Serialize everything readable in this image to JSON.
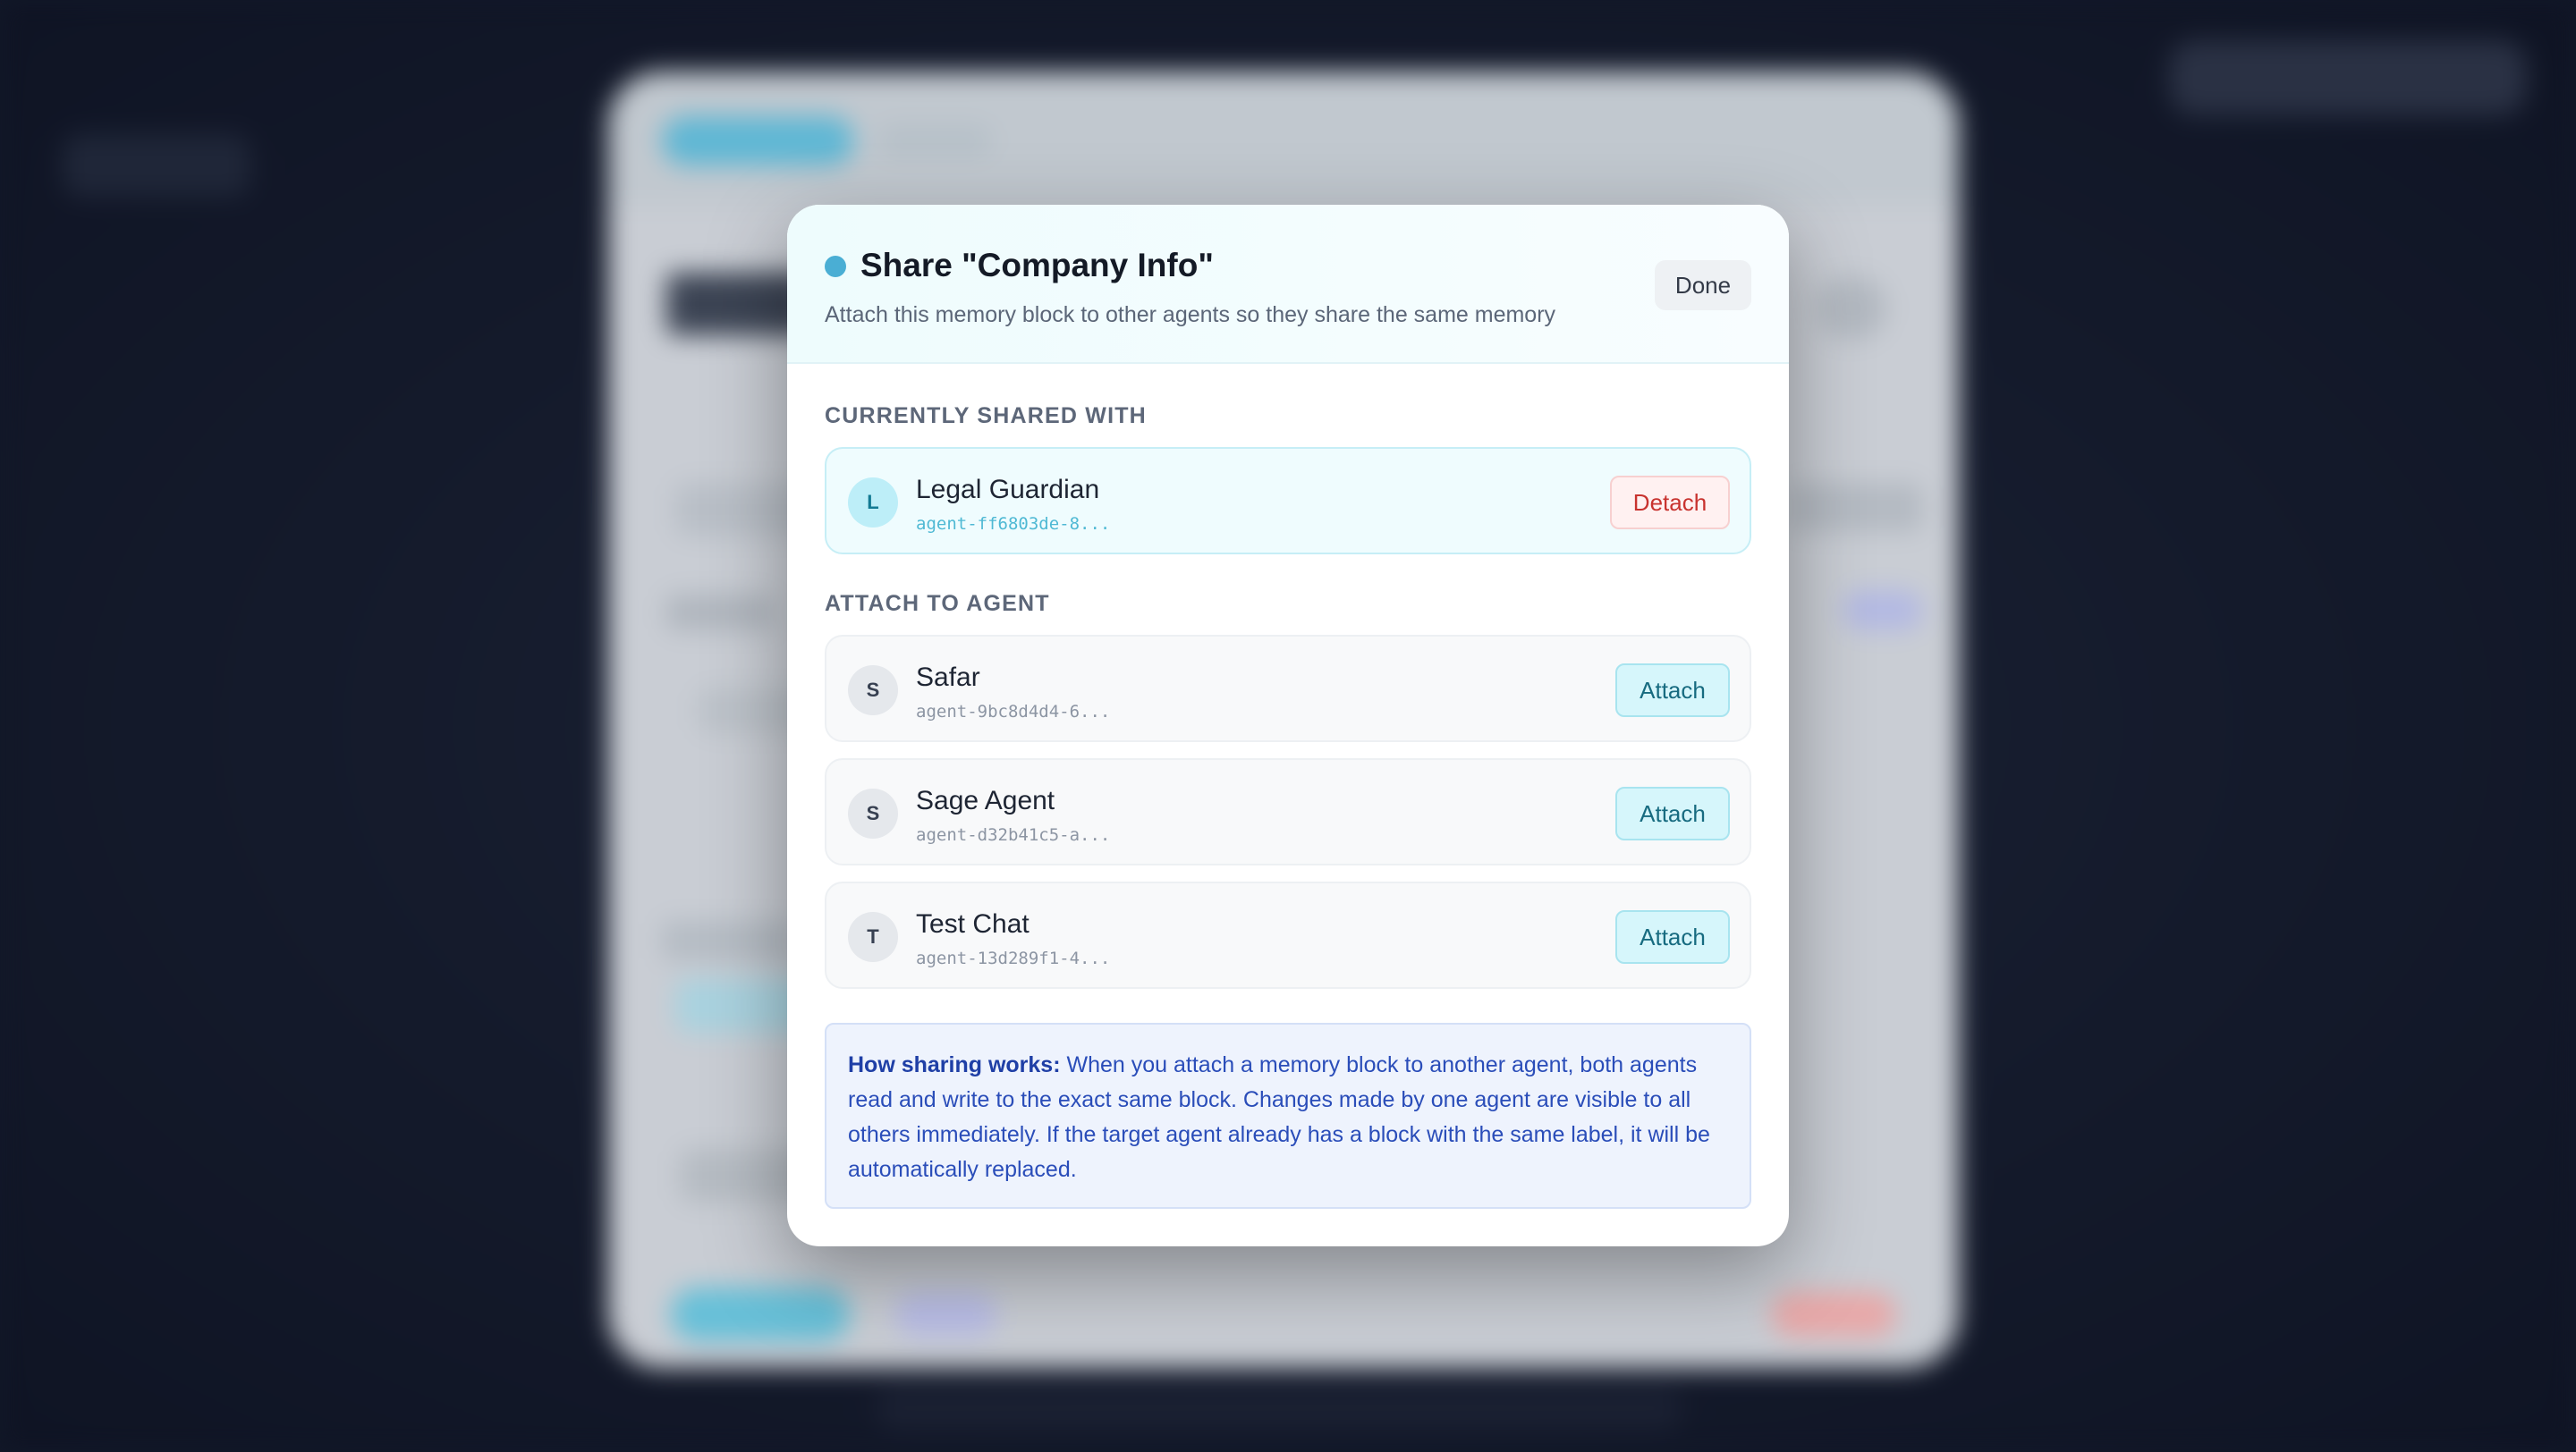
{
  "modal": {
    "title": "Share \"Company Info\"",
    "subtitle": "Attach this memory block to other agents so they share the same memory",
    "done_label": "Done",
    "accent_color": "#4aaed4"
  },
  "shared_section": {
    "label": "CURRENTLY SHARED WITH",
    "agents": [
      {
        "initial": "L",
        "name": "Legal Guardian",
        "id": "agent-ff6803de-8...",
        "action": "Detach"
      }
    ]
  },
  "attach_section": {
    "label": "ATTACH TO AGENT",
    "agents": [
      {
        "initial": "S",
        "name": "Safar",
        "id": "agent-9bc8d4d4-6...",
        "action": "Attach"
      },
      {
        "initial": "S",
        "name": "Sage Agent",
        "id": "agent-d32b41c5-a...",
        "action": "Attach"
      },
      {
        "initial": "T",
        "name": "Test Chat",
        "id": "agent-13d289f1-4...",
        "action": "Attach"
      }
    ]
  },
  "info": {
    "lead": "How sharing works:",
    "body": " When you attach a memory block to another agent, both agents read and write to the exact same block. Changes made by one agent are visible to all others immediately. If the target agent already has a block with the same label, it will be automatically replaced."
  }
}
